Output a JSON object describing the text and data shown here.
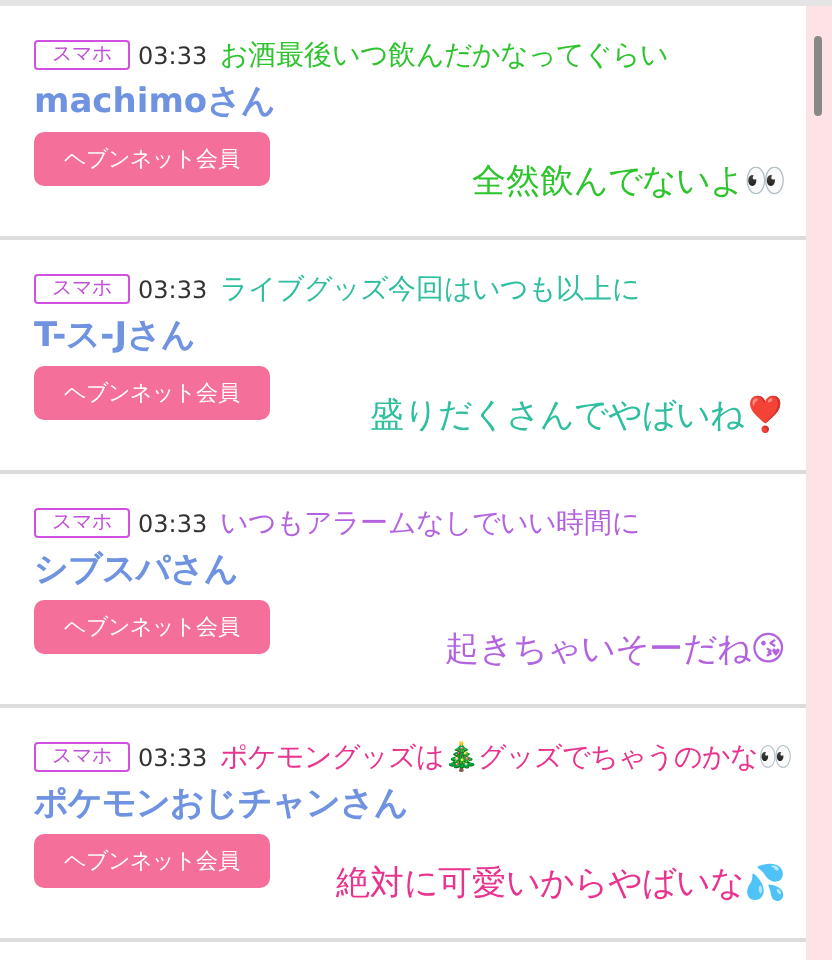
{
  "posts": [
    {
      "device": "スマホ",
      "time": "03:33",
      "name": "machimoさん",
      "member_button": "ヘブンネット会員",
      "caption": {
        "color": "#2ec42e",
        "lines": [
          "お酒最後いつ飲んだかなってぐらい",
          "全然飲んでないよ👀"
        ]
      }
    },
    {
      "device": "スマホ",
      "time": "03:33",
      "name": "T-ス-Jさん",
      "member_button": "ヘブンネット会員",
      "caption": {
        "color": "#2dbf9f",
        "lines": [
          "ライブグッズ今回はいつも以上に",
          "盛りだくさんでやばいね❣️"
        ]
      }
    },
    {
      "device": "スマホ",
      "time": "03:33",
      "name": "シブスパさん",
      "member_button": "ヘブンネット会員",
      "caption": {
        "color": "#b463e0",
        "lines": [
          "いつもアラームなしでいい時間に",
          "起きちゃいそーだね😘"
        ]
      }
    },
    {
      "device": "スマホ",
      "time": "03:33",
      "name": "ポケモンおじチャンさん",
      "member_button": "ヘブンネット会員",
      "caption": {
        "color": "#e8338f",
        "lines": [
          "ポケモングッズは🎄グッズでちゃうのかな👀",
          "絶対に可愛いからやばいな💦"
        ]
      }
    }
  ]
}
